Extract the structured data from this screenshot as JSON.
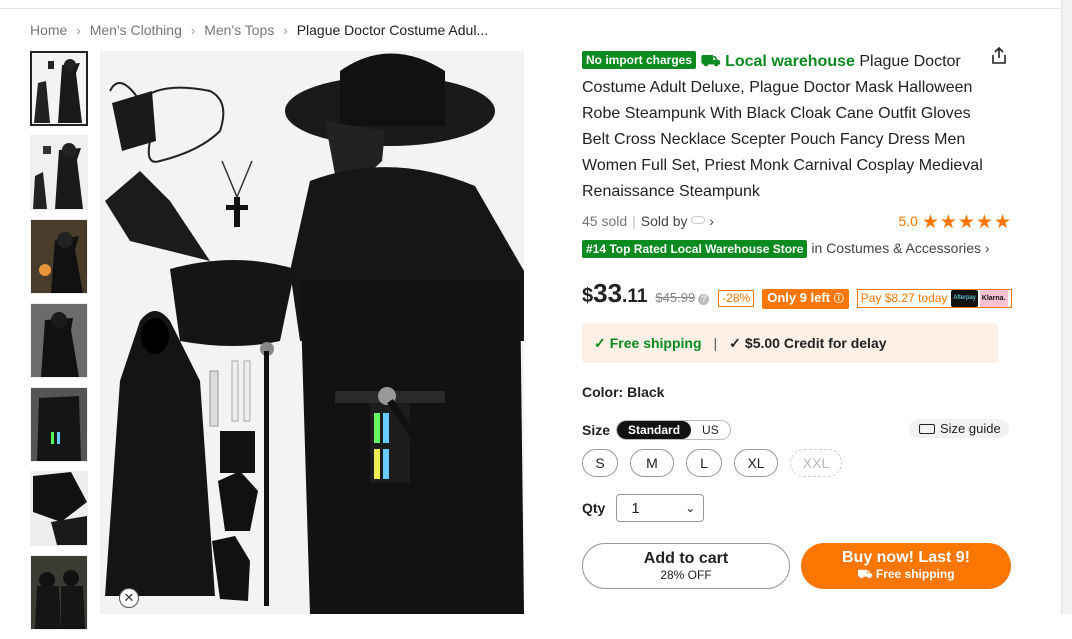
{
  "breadcrumb": [
    "Home",
    "Men's Clothing",
    "Men's Tops",
    "Plague Doctor Costume Adul..."
  ],
  "product": {
    "badge_import": "No import charges",
    "local_warehouse": "Local warehouse",
    "title": "Plague Doctor Costume Adult Deluxe, Plague Doctor Mask Halloween Robe Steampunk With Black Cloak Cane Outfit Gloves Belt Cross Necklace Scepter Pouch Fancy Dress Men Women Full Set, Priest Monk Carnival Cosplay Medieval Renaissance Steampunk",
    "sold": "45 sold",
    "sold_by": "Sold by",
    "rating": "5.0",
    "stars": "★★★★★",
    "top_rated_tag": "#14 Top Rated Local Warehouse Store",
    "top_rated_category": "in Costumes & Accessories",
    "price_currency": "$",
    "price_main": "33",
    "price_cents": ".11",
    "price_was": "$45.99",
    "discount": "-28%",
    "stock": "Only 9 left",
    "pay_later": "Pay $8.27 today",
    "pay_afterpay": "Afterpay",
    "pay_klarna": "Klarna.",
    "free_shipping": "Free shipping",
    "credit": "$5.00 Credit for delay",
    "color_label": "Color: Black",
    "size_label": "Size",
    "size_tabs": [
      "Standard",
      "US"
    ],
    "size_guide": "Size guide",
    "sizes": [
      "S",
      "M",
      "L",
      "XL",
      "XXL"
    ],
    "qty_label": "Qty",
    "qty_value": "1",
    "add_to_cart": "Add to cart",
    "add_to_cart_sub": "28% OFF",
    "buy_now": "Buy now! Last 9!",
    "buy_now_sub": "Free shipping"
  },
  "colors": {
    "accent": "#fb7701",
    "green": "#0a8a1f"
  }
}
